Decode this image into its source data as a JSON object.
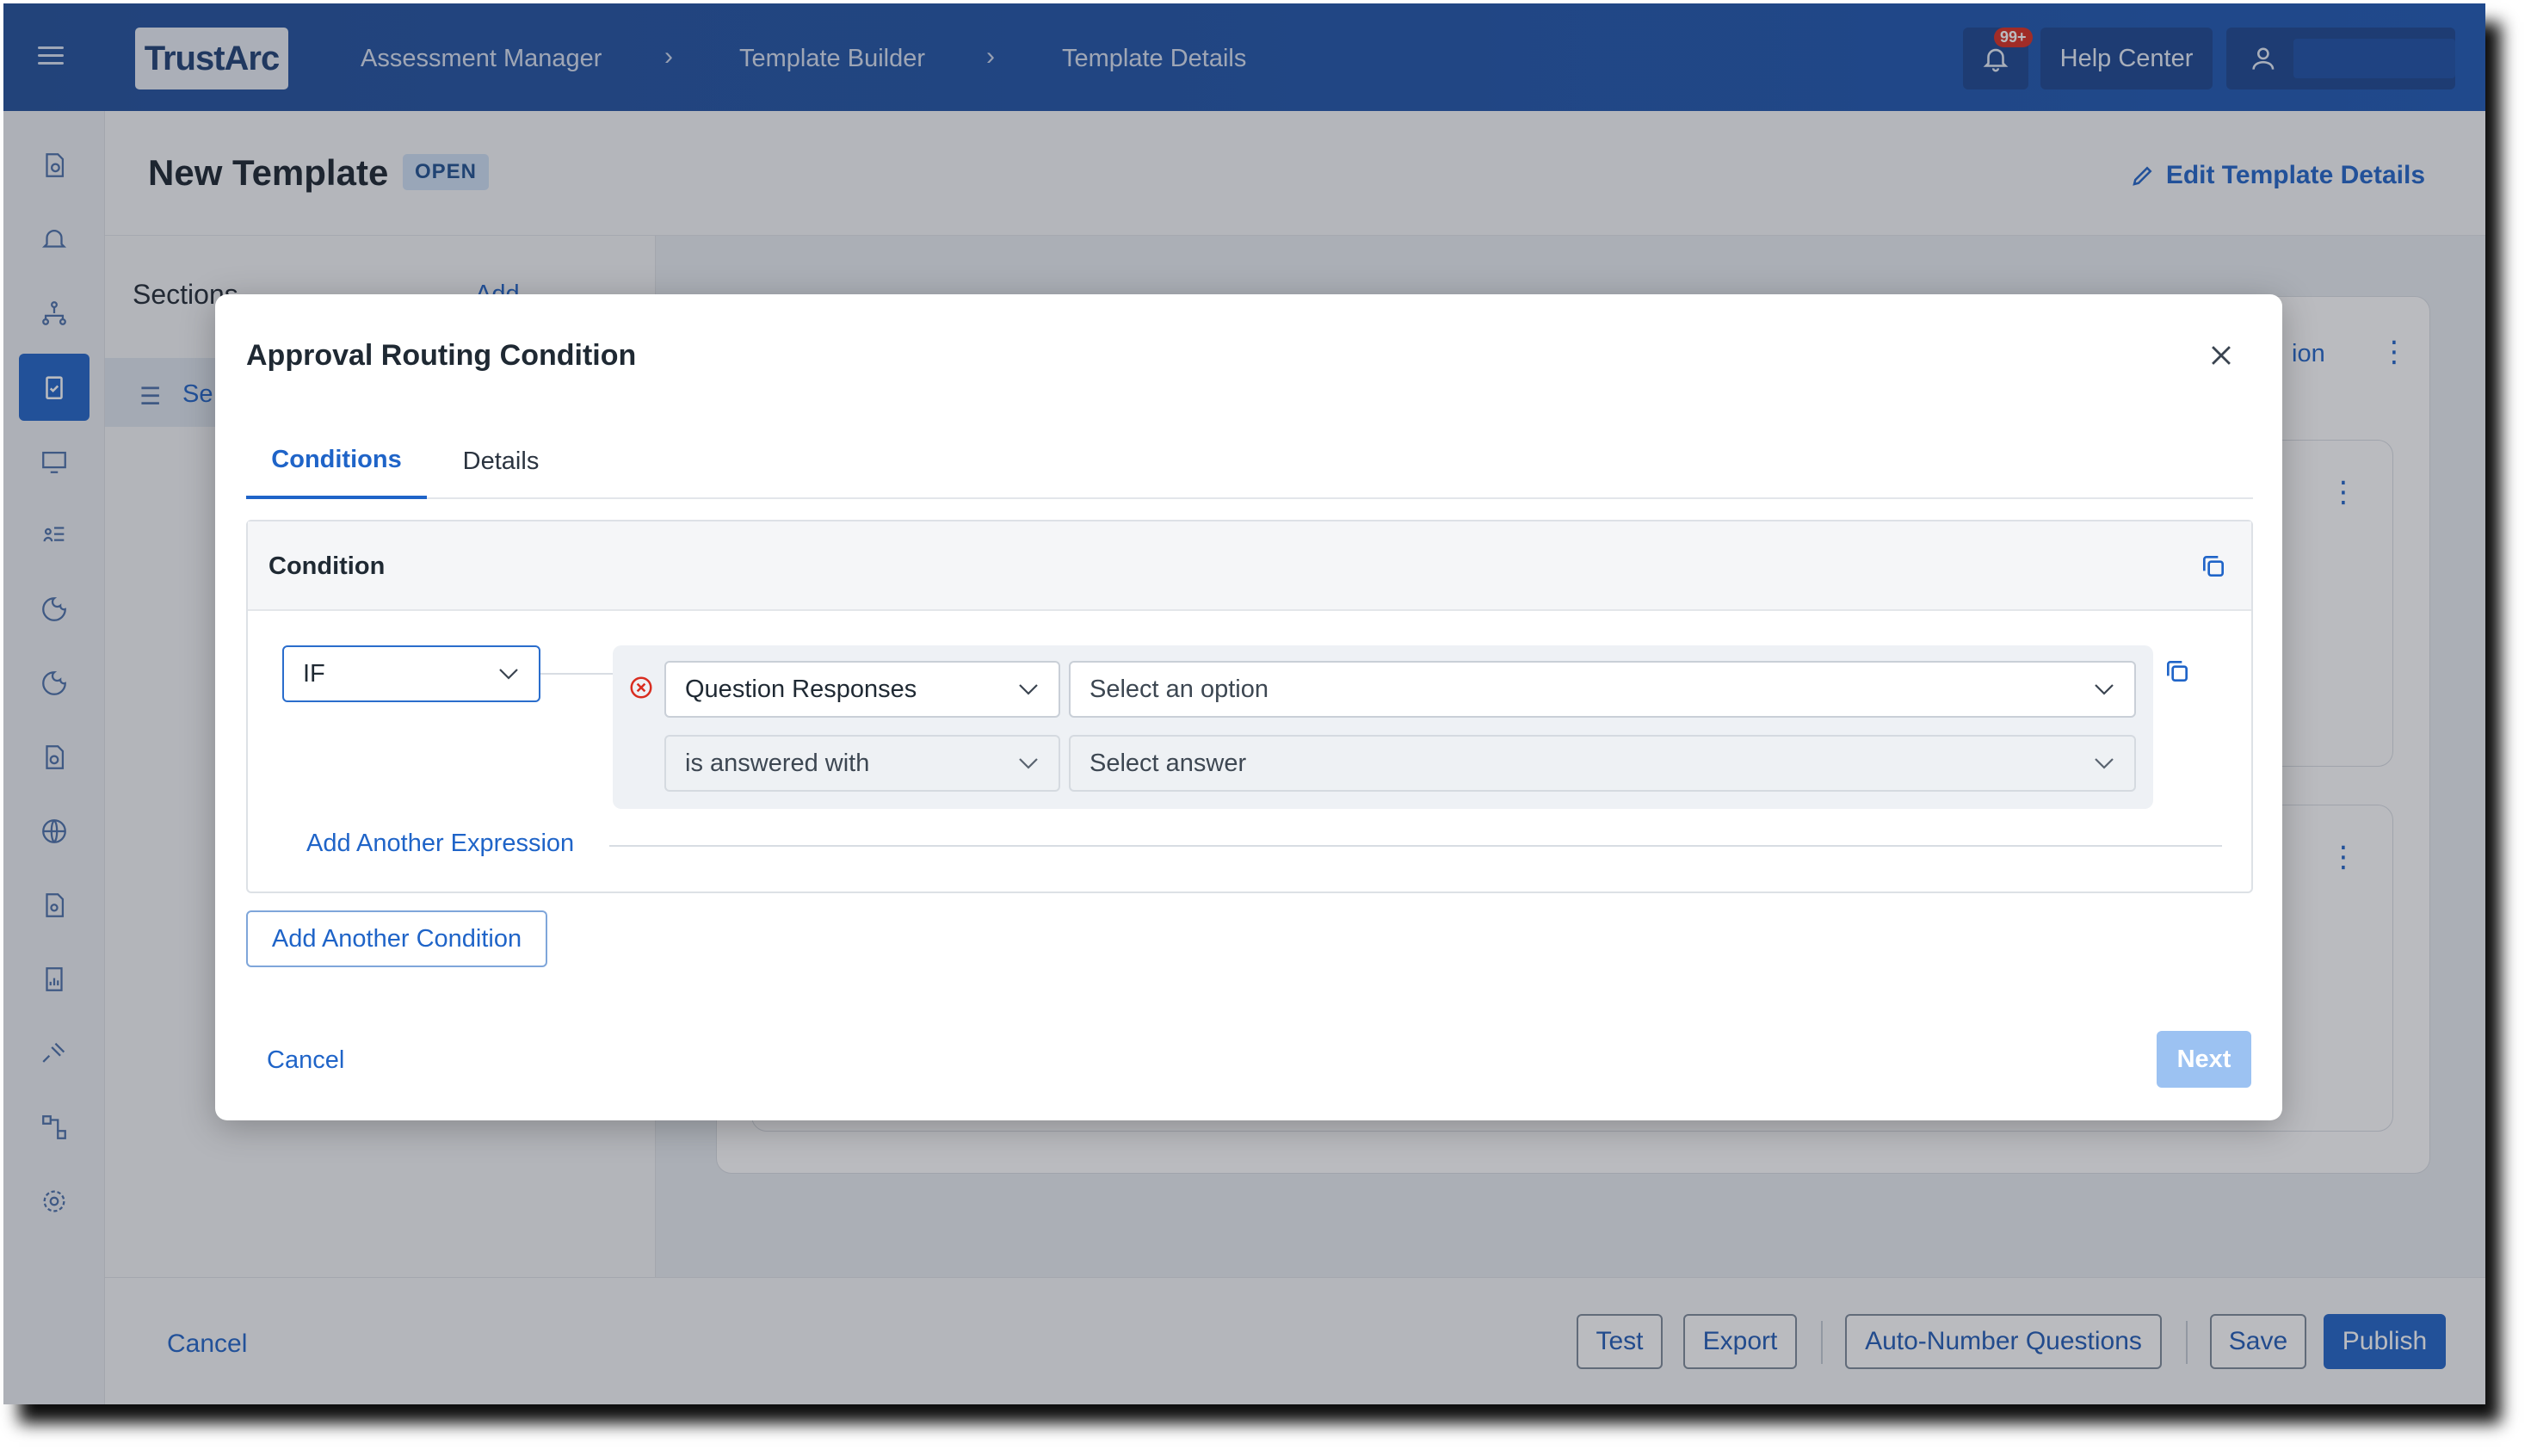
{
  "topbar": {
    "logo": "TrustArc",
    "breadcrumbs": [
      "Assessment Manager",
      "Template Builder",
      "Template Details"
    ],
    "notification_count": "99+",
    "help_label": "Help Center",
    "user_name": ""
  },
  "page": {
    "title": "New Template",
    "status_badge": "OPEN",
    "edit_link": "Edit Template Details"
  },
  "sections_panel": {
    "label": "Sections",
    "add_label": "Add",
    "first_section": "Se"
  },
  "bottom_bar": {
    "cancel_label": "Cancel",
    "test_label": "Test",
    "export_label": "Export",
    "auto_number_label": "Auto-Number Questions",
    "save_label": "Save",
    "publish_label": "Publish"
  },
  "background_card": {
    "partial_text": "ion"
  },
  "modal": {
    "title": "Approval Routing Condition",
    "tabs": [
      {
        "label": "Conditions",
        "active": true
      },
      {
        "label": "Details",
        "active": false
      }
    ],
    "condition": {
      "header": "Condition",
      "operator": "IF",
      "expression": {
        "source": "Question Responses",
        "question_placeholder": "Select an option",
        "comparator": "is answered with",
        "answer_placeholder": "Select answer"
      },
      "add_expression_label": "Add Another Expression"
    },
    "add_condition_label": "Add Another Condition",
    "cancel_label": "Cancel",
    "next_label": "Next"
  },
  "colors": {
    "brand_blue": "#1f64c8",
    "topbar": "#1d57b4",
    "error_red": "#d92d20",
    "next_disabled": "#9cc2f2"
  }
}
